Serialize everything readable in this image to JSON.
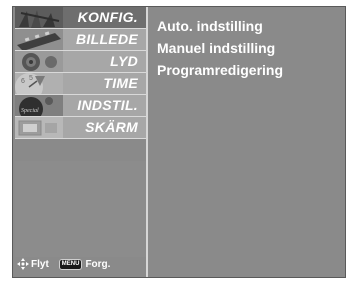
{
  "sidebar": {
    "items": [
      {
        "label": "KONFIG.",
        "icon": "setup-icon",
        "active": true
      },
      {
        "label": "BILLEDE",
        "icon": "picture-film-icon",
        "active": false
      },
      {
        "label": "LYD",
        "icon": "audio-speaker-icon",
        "active": false
      },
      {
        "label": "TIME",
        "icon": "clock-icon",
        "active": false
      },
      {
        "label": "INDSTIL.",
        "icon": "option-special-icon",
        "active": false
      },
      {
        "label": "SKÄRM",
        "icon": "screen-icon",
        "active": false
      }
    ]
  },
  "content": {
    "options": [
      {
        "label": "Auto. indstilling"
      },
      {
        "label": "Manuel indstilling"
      },
      {
        "label": "Programredigering"
      }
    ]
  },
  "footer": {
    "move_label": "Flyt",
    "menu_key": "MENU",
    "back_label": "Forg."
  },
  "colors": {
    "panel": "#8a8a8a",
    "menu_item": "#a7a7a7",
    "active_item": "#6e6e6e",
    "text": "#ffffff"
  }
}
